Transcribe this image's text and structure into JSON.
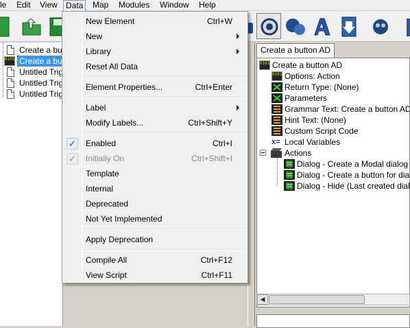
{
  "menubar": {
    "items": [
      "le",
      "Edit",
      "View",
      "Data",
      "Map",
      "Modules",
      "Window",
      "Help"
    ]
  },
  "left_tree": {
    "items": [
      "Create a butto",
      "Create a butto",
      "Untitled Trigg",
      "Untitled Trigg",
      "Untitled Trigg"
    ]
  },
  "right_panel": {
    "tab_label": "Create a button AD",
    "nodes": {
      "root": "Create a button AD",
      "options": "Options: Action",
      "return_type": "Return Type: (None)",
      "parameters": "Parameters",
      "grammar": "Grammar Text: Create a button AD()",
      "hint": "Hint Text: (None)",
      "custom_script": "Custom Script Code",
      "local_vars": "Local Variables",
      "actions": "Actions",
      "action_1": "Dialog - Create a Modal dialog of si",
      "action_2": "Dialog - Create a button for dialog (",
      "action_3": "Dialog - Hide (Last created dialog) f"
    }
  },
  "data_menu": {
    "new_element": "New Element",
    "new_element_sc": "Ctrl+W",
    "new": "New",
    "library": "Library",
    "reset_all": "Reset All Data",
    "element_properties": "Element Properties...",
    "element_properties_sc": "Ctrl+Enter",
    "label": "Label",
    "modify_labels": "Modify Labels...",
    "modify_labels_sc": "Ctrl+Shift+Y",
    "enabled": "Enabled",
    "enabled_sc": "Ctrl+I",
    "initially_on": "Initially On",
    "initially_on_sc": "Ctrl+Shift+I",
    "template": "Template",
    "internal": "Internal",
    "deprecated": "Deprecated",
    "not_yet_implemented": "Not Yet Implemented",
    "apply_deprecation": "Apply Deprecation",
    "compile_all": "Compile All",
    "compile_all_sc": "Ctrl+F12",
    "view_script": "View Script",
    "view_script_sc": "Ctrl+F11",
    "check_glyph": "✓"
  },
  "binary_icon_text": "0101",
  "local_vars_icon_text": "x=",
  "colors": {
    "selection": "#3399ff",
    "check": "#2a5db0"
  }
}
